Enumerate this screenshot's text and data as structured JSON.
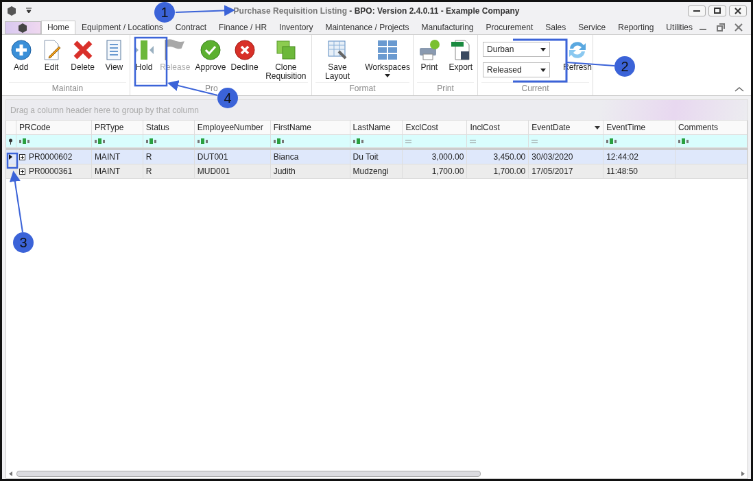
{
  "window": {
    "title_document": "Purchase Requisition Listing",
    "title_app": "- BPO: Version 2.4.0.11 - Example Company"
  },
  "tabs": [
    {
      "label": "Home",
      "selected": true
    },
    {
      "label": "Equipment / Locations",
      "selected": false
    },
    {
      "label": "Contract",
      "selected": false
    },
    {
      "label": "Finance / HR",
      "selected": false
    },
    {
      "label": "Inventory",
      "selected": false
    },
    {
      "label": "Maintenance / Projects",
      "selected": false
    },
    {
      "label": "Manufacturing",
      "selected": false
    },
    {
      "label": "Procurement",
      "selected": false
    },
    {
      "label": "Sales",
      "selected": false
    },
    {
      "label": "Service",
      "selected": false
    },
    {
      "label": "Reporting",
      "selected": false
    },
    {
      "label": "Utilities",
      "selected": false
    }
  ],
  "ribbon": [
    {
      "label": "Maintain",
      "buttons": [
        {
          "kind": "add",
          "label": "Add",
          "disabled": false
        },
        {
          "kind": "edit",
          "label": "Edit",
          "disabled": false
        },
        {
          "kind": "delete",
          "label": "Delete",
          "disabled": false
        },
        {
          "kind": "view",
          "label": "View",
          "disabled": false
        }
      ]
    },
    {
      "label": "Pro",
      "buttons": [
        {
          "kind": "hold",
          "label": "Hold",
          "disabled": false
        },
        {
          "kind": "release",
          "label": "Release",
          "disabled": true
        },
        {
          "kind": "approve",
          "label": "Approve",
          "disabled": false
        },
        {
          "kind": "decline",
          "label": "Decline",
          "disabled": false
        },
        {
          "kind": "clone",
          "label": "Clone Requisition",
          "disabled": false
        }
      ]
    },
    {
      "label": "Format",
      "buttons": [
        {
          "kind": "layout",
          "label": "Save Layout",
          "disabled": false
        },
        {
          "kind": "workspaces",
          "label": "Workspaces",
          "disabled": false
        }
      ]
    },
    {
      "label": "Print",
      "buttons": [
        {
          "kind": "print",
          "label": "Print",
          "disabled": false
        },
        {
          "kind": "export",
          "label": "Export",
          "disabled": false
        }
      ]
    },
    {
      "label": "Current",
      "combos": [
        "Durban",
        "Released"
      ],
      "buttons": [
        {
          "kind": "refresh",
          "label": "Refresh",
          "disabled": false
        }
      ]
    }
  ],
  "group_panel": {
    "hint": "Drag a column header here to group by that column"
  },
  "table": {
    "columns": [
      {
        "label": "PRCode",
        "kind": "text",
        "sorted": false
      },
      {
        "label": "PRType",
        "kind": "text",
        "sorted": false
      },
      {
        "label": "Status",
        "kind": "text",
        "sorted": false
      },
      {
        "label": "EmployeeNumber",
        "kind": "text",
        "sorted": false
      },
      {
        "label": "FirstName",
        "kind": "text",
        "sorted": false
      },
      {
        "label": "LastName",
        "kind": "text",
        "sorted": false
      },
      {
        "label": "ExclCost",
        "kind": "number",
        "sorted": false
      },
      {
        "label": "InclCost",
        "kind": "number",
        "sorted": false
      },
      {
        "label": "EventDate",
        "kind": "number",
        "sorted": true
      },
      {
        "label": "EventTime",
        "kind": "text",
        "sorted": false
      },
      {
        "label": "Comments",
        "kind": "text",
        "sorted": false
      }
    ],
    "rows": [
      {
        "selected": true,
        "cells": [
          "PR0000602",
          "MAINT",
          "R",
          "DUT001",
          "Bianca",
          "Du Toit",
          "3,000.00",
          "3,450.00",
          "30/03/2020",
          "12:44:02",
          ""
        ]
      },
      {
        "selected": false,
        "cells": [
          "PR0000361",
          "MAINT",
          "R",
          "MUD001",
          "Judith",
          "Mudzengi",
          "1,700.00",
          "1,700.00",
          "17/05/2017",
          "11:48:50",
          ""
        ]
      }
    ]
  },
  "annotations": [
    {
      "label": "1"
    },
    {
      "label": "2"
    },
    {
      "label": "3"
    },
    {
      "label": "4"
    }
  ]
}
